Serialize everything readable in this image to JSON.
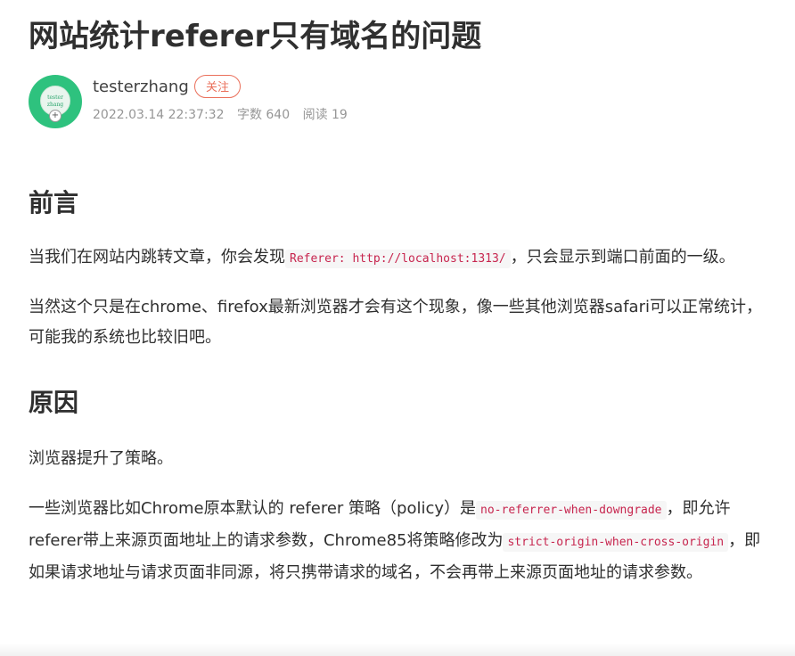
{
  "article": {
    "title": "网站统计referer只有域名的问题"
  },
  "author": {
    "avatar_text_line1": "tester",
    "avatar_text_line2": "zhang",
    "name": "testerzhang",
    "follow_label": "关注",
    "date": "2022.03.14 22:37:32",
    "word_count": "字数 640",
    "read_count": "阅读 19"
  },
  "sections": {
    "preface": {
      "heading": "前言",
      "p1_a": "当我们在网站内跳转文章，你会发现",
      "p1_code": "Referer: http://localhost:1313/",
      "p1_b": "，只会显示到端口前面的一级。",
      "p2": "当然这个只是在chrome、firefox最新浏览器才会有这个现象，像一些其他浏览器safari可以正常统计，可能我的系统也比较旧吧。"
    },
    "cause": {
      "heading": "原因",
      "p3": "浏览器提升了策略。",
      "p4_a": "一些浏览器比如Chrome原本默认的 referer 策略（policy）是",
      "p4_code1": "no-referrer-when-downgrade",
      "p4_b": "，即允许referer带上来源页面地址上的请求参数，Chrome85将策略修改为",
      "p4_code2": "strict-origin-when-cross-origin",
      "p4_c": "，即如果请求地址与请求页面非同源，将只携带请求的域名，不会再带上来源页面地址的请求参数。"
    }
  },
  "colors": {
    "follow_accent": "#ea6f5a",
    "avatar_bg": "#2ec27e",
    "code_text": "#c7254e"
  }
}
